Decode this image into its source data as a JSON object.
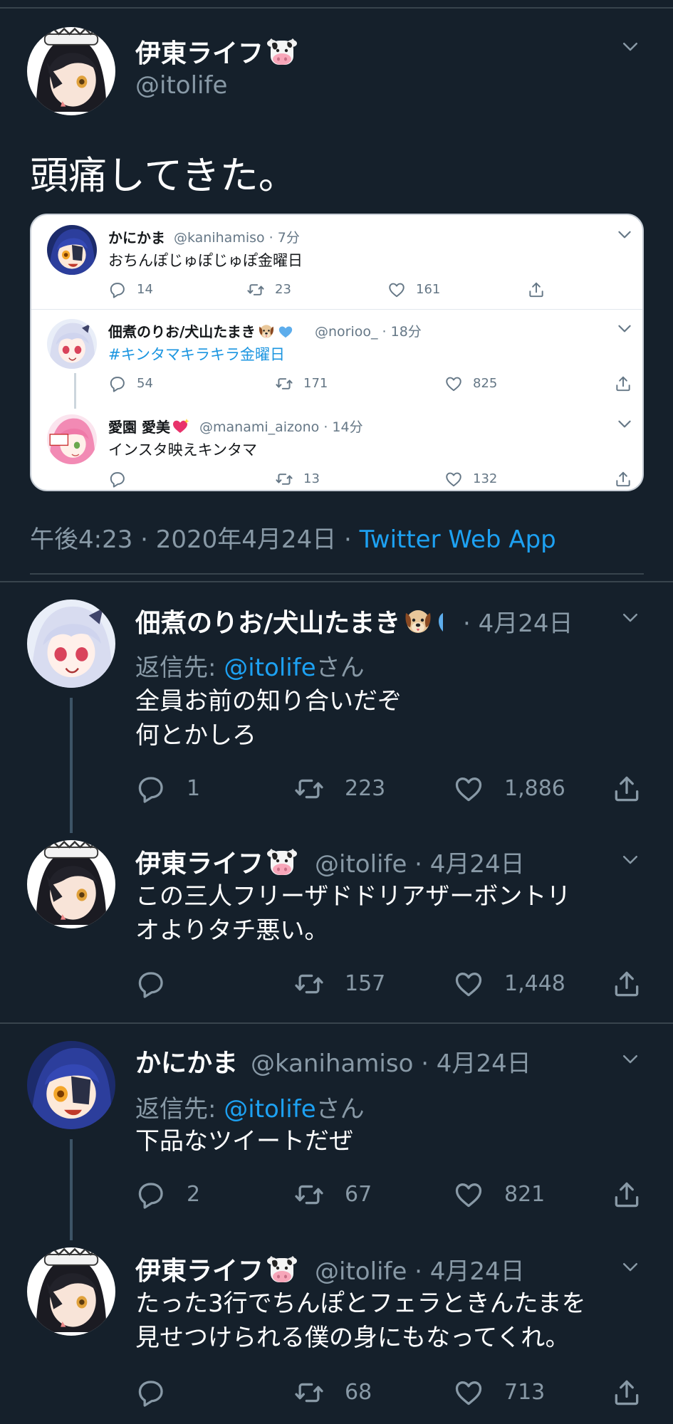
{
  "main_tweet": {
    "name": "伊東ライフ",
    "handle": "@itolife",
    "text": "頭痛してきた。",
    "timestamp": "午後4:23 · 2020年4月24日 · ",
    "source": "Twitter Web App"
  },
  "embedded": {
    "tweets": [
      {
        "name": "かにかま",
        "handle": "@kanihamiso · 7分",
        "text": "おちんぽじゅぽじゅぽ金曜日",
        "reply": "14",
        "retweet": "23",
        "like": "161"
      },
      {
        "name": "佃煮のりお/犬山たまき",
        "handle": "@norioo_ · 18分",
        "text": "#キンタマキラキラ金曜日",
        "reply": "54",
        "retweet": "171",
        "like": "825"
      },
      {
        "name": "愛園 愛美",
        "handle": "@manami_aizono · 14分",
        "text": "インスタ映えキンタマ",
        "reply": "",
        "retweet": "13",
        "like": "132"
      }
    ]
  },
  "replies": [
    {
      "name": "佃煮のりお/犬山たまき",
      "meta": "· 4月24日",
      "reply_prefix": "返信先: ",
      "reply_mention": "@itolife",
      "reply_suffix": "さん",
      "line1": "全員お前の知り合いだぞ",
      "line2": "何とかしろ",
      "reply": "1",
      "retweet": "223",
      "like": "1,886"
    },
    {
      "name": "伊東ライフ",
      "meta": "@itolife · 4月24日",
      "line1": "この三人フリーザドドリアザーボントリ",
      "line2": "オよりタチ悪い。",
      "reply": "",
      "retweet": "157",
      "like": "1,448"
    },
    {
      "name": "かにかま",
      "meta": "@kanihamiso · 4月24日",
      "reply_prefix": "返信先: ",
      "reply_mention": "@itolife",
      "reply_suffix": "さん",
      "line1": "下品なツイートだぜ",
      "reply": "2",
      "retweet": "67",
      "like": "821"
    },
    {
      "name": "伊東ライフ",
      "meta": "@itolife · 4月24日",
      "line1": "たった3行でちんぽとフェラときんたまを",
      "line2": "見せつけられる僕の身にもなってくれ。",
      "reply": "",
      "retweet": "68",
      "like": "713"
    }
  ],
  "colors": {
    "background": "#15202b",
    "secondary_text": "#8899a6",
    "link": "#1da1f2",
    "divider": "#38444d"
  },
  "icons": [
    "maid-avatar",
    "kanikama-avatar",
    "norio-avatar",
    "manami-avatar",
    "cow-emoji",
    "dog-emoji",
    "blue-heart-emoji",
    "chevron-down-icon",
    "reply-icon",
    "retweet-icon",
    "like-icon",
    "share-icon"
  ]
}
